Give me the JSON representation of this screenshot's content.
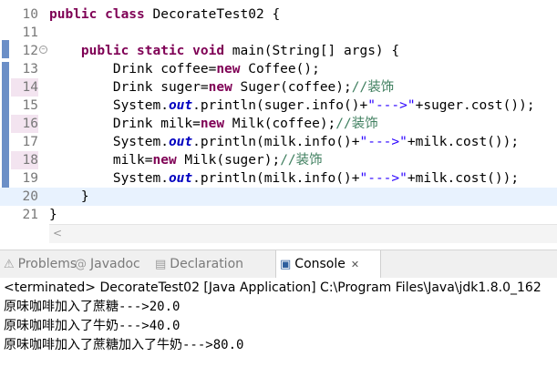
{
  "editor": {
    "lines": [
      {
        "n": "10",
        "parts": [
          [
            "kw",
            "public "
          ],
          [
            "kw",
            "class "
          ],
          [
            "",
            "DecorateTest02 {"
          ]
        ]
      },
      {
        "n": "11",
        "parts": []
      },
      {
        "n": "12",
        "parts": [
          [
            "",
            "    "
          ],
          [
            "kw",
            "public "
          ],
          [
            "kw",
            "static "
          ],
          [
            "kw",
            "void "
          ],
          [
            "",
            "main(String[] args) {"
          ]
        ]
      },
      {
        "n": "13",
        "parts": [
          [
            "",
            "        Drink coffee="
          ],
          [
            "kw",
            "new "
          ],
          [
            "",
            "Coffee();"
          ]
        ]
      },
      {
        "n": "14",
        "parts": [
          [
            "",
            "        Drink suger="
          ],
          [
            "kw",
            "new "
          ],
          [
            "",
            "Suger(coffee);"
          ],
          [
            "cmt",
            "//装饰"
          ]
        ]
      },
      {
        "n": "15",
        "parts": [
          [
            "",
            "        System."
          ],
          [
            "fld",
            "out"
          ],
          [
            "",
            ".println(suger.info()+"
          ],
          [
            "str",
            "\"--->\""
          ],
          [
            "",
            "+suger.cost());"
          ]
        ]
      },
      {
        "n": "16",
        "parts": [
          [
            "",
            "        Drink milk="
          ],
          [
            "kw",
            "new "
          ],
          [
            "",
            "Milk(coffee);"
          ],
          [
            "cmt",
            "//装饰"
          ]
        ]
      },
      {
        "n": "17",
        "parts": [
          [
            "",
            "        System."
          ],
          [
            "fld",
            "out"
          ],
          [
            "",
            ".println(milk.info()+"
          ],
          [
            "str",
            "\"--->\""
          ],
          [
            "",
            "+milk.cost());"
          ]
        ]
      },
      {
        "n": "18",
        "parts": [
          [
            "",
            "        milk="
          ],
          [
            "kw",
            "new "
          ],
          [
            "",
            "Milk(suger);"
          ],
          [
            "cmt",
            "//装饰"
          ]
        ]
      },
      {
        "n": "19",
        "parts": [
          [
            "",
            "        System."
          ],
          [
            "fld",
            "out"
          ],
          [
            "",
            ".println(milk.info()+"
          ],
          [
            "str",
            "\"--->\""
          ],
          [
            "",
            "+milk.cost());"
          ]
        ]
      },
      {
        "n": "20",
        "parts": [
          [
            "",
            "    }"
          ]
        ]
      },
      {
        "n": "21",
        "parts": [
          [
            "",
            "}"
          ]
        ]
      }
    ]
  },
  "tabs": [
    {
      "label": "Problems",
      "icon": "problems-icon",
      "glyph": "⚠"
    },
    {
      "label": "Javadoc",
      "icon": "javadoc-icon",
      "glyph": "@"
    },
    {
      "label": "Declaration",
      "icon": "declaration-icon",
      "glyph": "▤"
    },
    {
      "label": "Console",
      "icon": "console-icon",
      "glyph": "▣",
      "active": true,
      "close": "✕"
    }
  ],
  "console": {
    "header": "<terminated> DecorateTest02 [Java Application] C:\\Program Files\\Java\\jdk1.8.0_162",
    "output": [
      "原味咖啡加入了蔗糖--->20.0",
      "原味咖啡加入了牛奶--->40.0",
      "原味咖啡加入了蔗糖加入了牛奶--->80.0"
    ]
  },
  "colors": {
    "keyword": "#7f0055",
    "string": "#2a00ff",
    "comment": "#3f7f5f",
    "field": "#0000c0"
  }
}
